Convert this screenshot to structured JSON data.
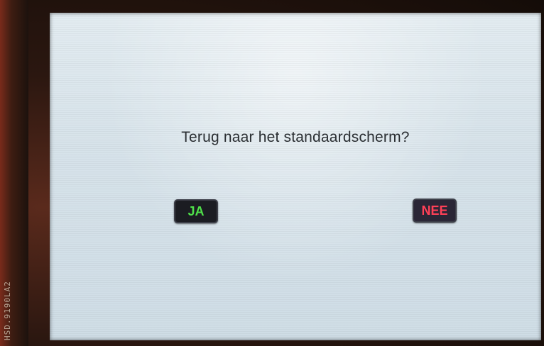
{
  "dialog": {
    "question": "Terug naar het standaardscherm?",
    "yes_label": "JA",
    "no_label": "NEE"
  },
  "device": {
    "board_label": "HSD.9190LA2"
  },
  "colors": {
    "yes_text": "#4fe04a",
    "no_text": "#ff4057",
    "screen_background": "#d7e3ea"
  }
}
